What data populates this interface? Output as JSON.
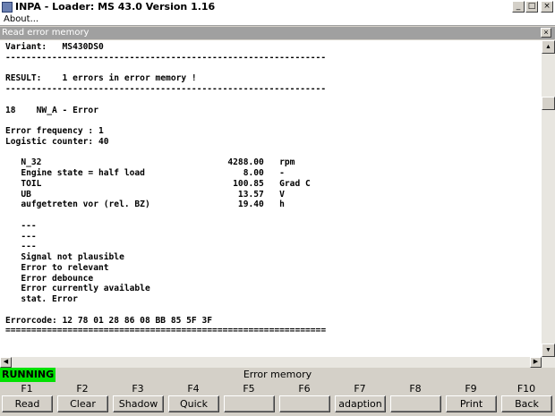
{
  "window": {
    "title": "INPA - Loader: MS 43.0 Version 1.16",
    "minimize": "_",
    "maximize": "□",
    "close": "×"
  },
  "menu": {
    "about": "About..."
  },
  "subwindow": {
    "title": "Read error memory",
    "close": "×"
  },
  "content_lines": [
    "Variant:   MS430DS0",
    "--------------------------------------------------------------",
    "",
    "RESULT:    1 errors in error memory !",
    "--------------------------------------------------------------",
    "",
    "18    NW_A - Error",
    "",
    "Error frequency : 1",
    "Logistic counter: 40",
    "",
    "   N_32                                    4288.00   rpm",
    "   Engine state = half load                   8.00   -",
    "   TOIL                                     100.85   Grad C",
    "   UB                                        13.57   V",
    "   aufgetreten vor (rel. BZ)                 19.40   h",
    "",
    "   ---",
    "   ---",
    "   ---",
    "   Signal not plausible",
    "   Error to relevant",
    "   Error debounce",
    "   Error currently available",
    "   stat. Error",
    "",
    "Errorcode: 12 78 01 28 86 08 BB 85 5F 3F",
    "=============================================================="
  ],
  "status": {
    "state": "RUNNING",
    "screen": "Error memory",
    "state_color": "#00e000"
  },
  "fkeys": [
    {
      "key": "F1",
      "label": "Read"
    },
    {
      "key": "F2",
      "label": "Clear"
    },
    {
      "key": "F3",
      "label": "Shadow"
    },
    {
      "key": "F4",
      "label": "Quick"
    },
    {
      "key": "F5",
      "label": ""
    },
    {
      "key": "F6",
      "label": ""
    },
    {
      "key": "F7",
      "label": "adaption"
    },
    {
      "key": "F8",
      "label": ""
    },
    {
      "key": "F9",
      "label": "Print"
    },
    {
      "key": "F10",
      "label": "Back"
    }
  ]
}
